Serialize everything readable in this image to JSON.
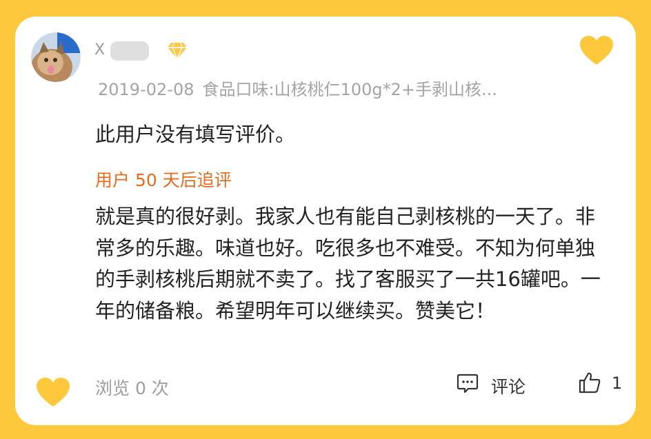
{
  "review": {
    "username": "X",
    "date": "2019-02-08",
    "variant": "食品口味:山核桃仁100g*2+手剥山核...",
    "empty_text": "此用户没有填写评价。",
    "followup_label": "用户 50 天后追评",
    "followup_text": "就是真的很好剥。我家人也有能自己剥核桃的一天了。非常多的乐趣。味道也好。吃很多也不难受。不知为何单独的手剥核桃后期就不卖了。找了客服买了一共16罐吧。一年的储备粮。希望明年可以继续买。赞美它！"
  },
  "footer": {
    "views": "浏览 0 次",
    "comment_label": "评论",
    "like_count": "1"
  },
  "icons": {
    "avatar": "cat-avatar",
    "vip": "diamond-icon",
    "heart": "heart-icon",
    "comment": "comment-icon",
    "like": "thumbs-up-icon"
  },
  "colors": {
    "background": "#FDC83C",
    "heart": "#FDC83C",
    "accent_orange": "#E56A1E",
    "muted_text": "#A3A3A3"
  }
}
